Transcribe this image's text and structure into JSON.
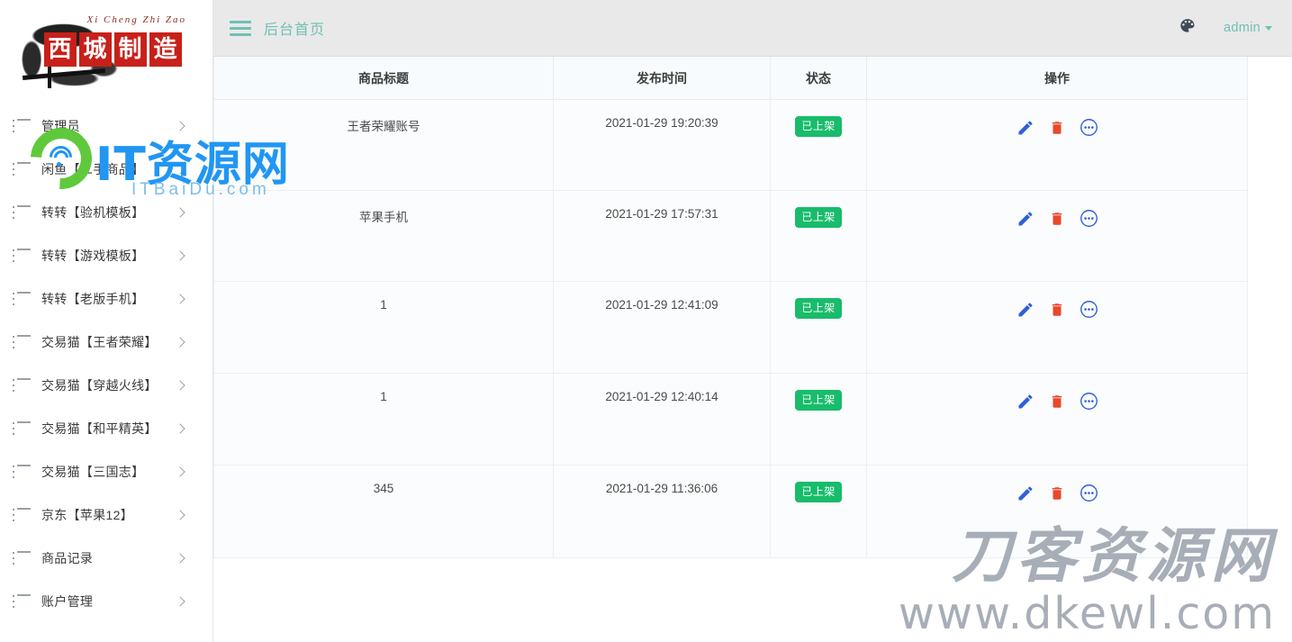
{
  "brand": {
    "pinyin": "Xi Cheng Zhi Zao",
    "seal_chars": [
      "西",
      "城",
      "制",
      "造"
    ]
  },
  "header": {
    "menu_toggle_icon": "hamburger-icon",
    "title": "后台首页",
    "theme_icon": "palette-icon",
    "user": "admin",
    "accent_color": "#6fc0b4",
    "background_color": "#e9e9e9"
  },
  "sidebar": {
    "items": [
      {
        "icon": "list-icon",
        "label": "管理员",
        "arrow": "chevron-right-icon"
      },
      {
        "icon": "list-icon",
        "label": "闲鱼【二手商品】",
        "arrow": "chevron-right-icon"
      },
      {
        "icon": "list-icon",
        "label": "转转【验机模板】",
        "arrow": "chevron-right-icon"
      },
      {
        "icon": "list-icon",
        "label": "转转【游戏模板】",
        "arrow": "chevron-right-icon"
      },
      {
        "icon": "list-icon",
        "label": "转转【老版手机】",
        "arrow": "chevron-right-icon"
      },
      {
        "icon": "list-icon",
        "label": "交易猫【王者荣耀】",
        "arrow": "chevron-right-icon"
      },
      {
        "icon": "list-icon",
        "label": "交易猫【穿越火线】",
        "arrow": "chevron-right-icon"
      },
      {
        "icon": "list-icon",
        "label": "交易猫【和平精英】",
        "arrow": "chevron-right-icon"
      },
      {
        "icon": "list-icon",
        "label": "交易猫【三国志】",
        "arrow": "chevron-right-icon"
      },
      {
        "icon": "list-icon",
        "label": "京东【苹果12】",
        "arrow": "chevron-right-icon"
      },
      {
        "icon": "list-icon",
        "label": "商品记录",
        "arrow": "chevron-right-icon"
      },
      {
        "icon": "list-icon",
        "label": "账户管理",
        "arrow": "chevron-right-icon"
      }
    ]
  },
  "table": {
    "columns": [
      "商品标题",
      "发布时间",
      "状态",
      "操作"
    ],
    "status_color": "#18bc6b",
    "action_icons": [
      "edit-pencil-icon",
      "delete-trash-icon",
      "more-options-icon"
    ],
    "rows": [
      {
        "title": "王者荣耀账号",
        "time": "2021-01-29 19:20:39",
        "status": "已上架"
      },
      {
        "title": "苹果手机",
        "time": "2021-01-29 17:57:31",
        "status": "已上架"
      },
      {
        "title": "1",
        "time": "2021-01-29 12:41:09",
        "status": "已上架"
      },
      {
        "title": "1",
        "time": "2021-01-29 12:40:14",
        "status": "已上架"
      },
      {
        "title": "345",
        "time": "2021-01-29 11:36:06",
        "status": "已上架"
      }
    ]
  },
  "watermarks": {
    "it": {
      "title": "IT资源网",
      "subtitle": "ITBaiDu.com"
    },
    "dk": {
      "title": "刀客资源网",
      "url": "www.dkewl.com"
    }
  }
}
